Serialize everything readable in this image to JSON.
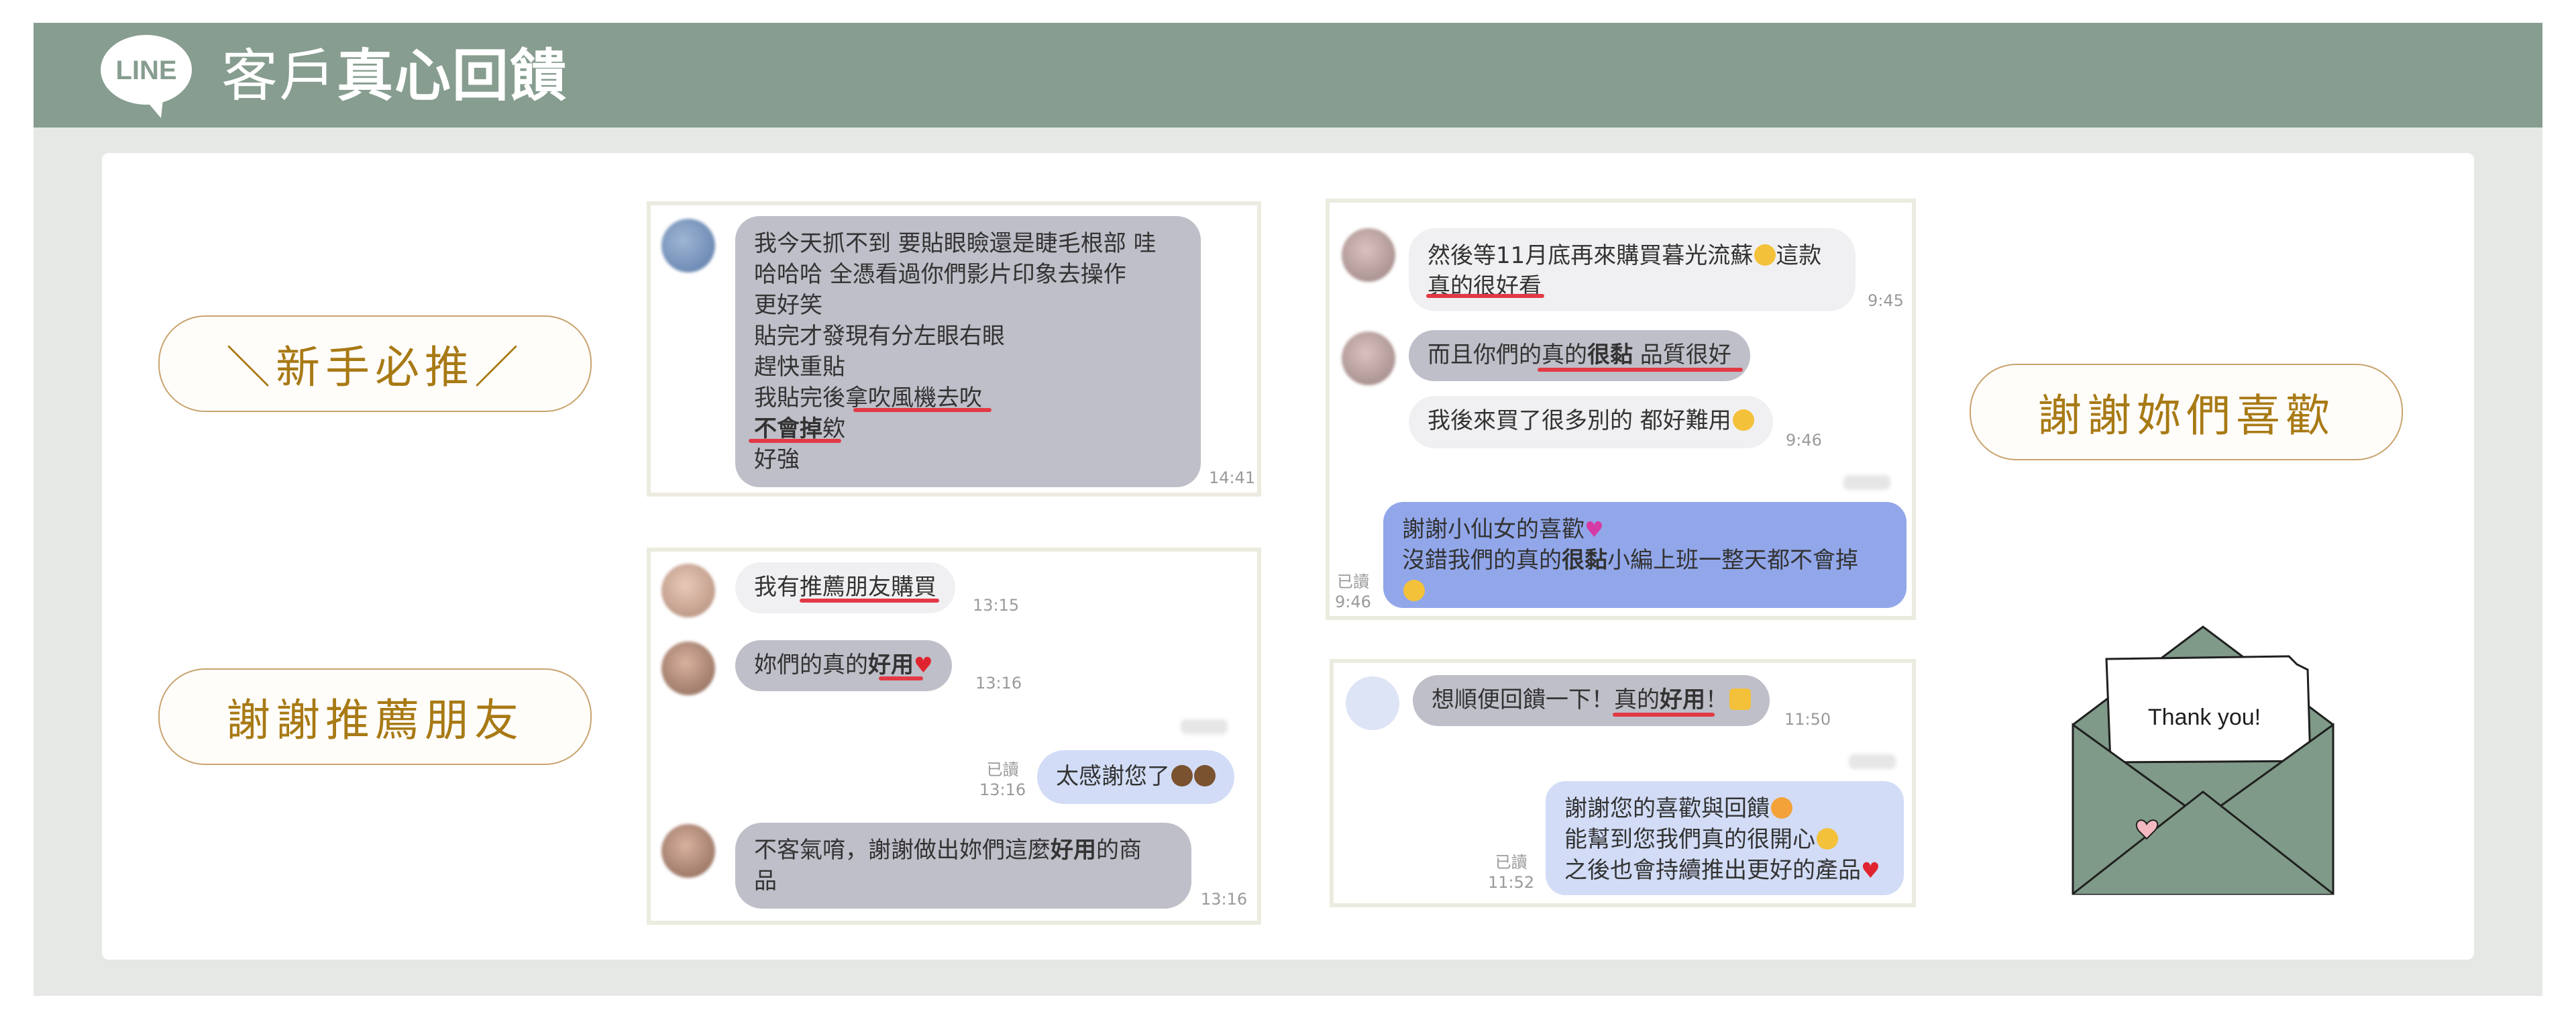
{
  "header": {
    "title_light": "客戶",
    "title_bold": "真心回饋",
    "logo_text": "LINE"
  },
  "pills": {
    "newbie": "＼新手必推／",
    "recommend": "謝謝推薦朋友",
    "thanks": "謝謝妳們喜歡"
  },
  "chat1": {
    "lines": [
      "我今天抓不到 要貼眼瞼還是睫毛根部 哇",
      "哈哈哈 全憑看過你們影片印象去操作",
      "更好笑",
      "貼完才發現有分左眼右眼",
      "趕快重貼",
      "我貼完後拿吹風機去吹"
    ],
    "line7_bold": "不會掉",
    "line7_rest": "欸",
    "line8": "好強",
    "time": "14:41"
  },
  "chat2": {
    "m1_prefix": "我有",
    "m1_highlight": "推薦朋友購買",
    "t1": "13:15",
    "m2_prefix": "妳們的真的",
    "m2_bold": "好用",
    "t2": "13:16",
    "m3": "太感謝您了",
    "read3": "已讀",
    "t3": "13:16",
    "m4_prefix": "不客氣唷，謝謝做出妳們這麼",
    "m4_bold": "好用",
    "m4_rest": "的商",
    "m4_line2": "品",
    "t4": "13:16"
  },
  "chat3": {
    "m1_line1": "然後等11月底再來購買暮光流蘇",
    "m1_after": "這款",
    "m1_line2": "真的很好看",
    "t1": "9:45",
    "m2_prefix": "而且你們的",
    "m2_mid": "真的",
    "m2_bold": "很黏",
    "m2_rest": " 品質很好",
    "m3": "我後來買了很多別的 都好難用",
    "t3": "9:46",
    "m4_line1": "謝謝小仙女的喜歡",
    "m4_line2_prefix": "沒錯我們的真的",
    "m4_line2_bold": "很黏",
    "m4_line2_rest": "小編上班一整天都不會掉",
    "read4": "已讀",
    "t4": "9:46"
  },
  "chat4": {
    "m1_prefix": "想順便回饋一下！",
    "m1_mid": "真的",
    "m1_bold": "好用",
    "m1_end": "！",
    "t1": "11:50",
    "m2_line1": "謝謝您的喜歡與回饋",
    "m2_line2": "能幫到您我們真的很開心",
    "m2_line3": "之後也會持續推出更好的產品",
    "read2": "已讀",
    "t2": "11:52"
  },
  "envelope": {
    "note": "Thank you!"
  },
  "colors": {
    "header": "#869d8f",
    "accent_gold": "#a87a15",
    "underline": "#e23a45",
    "envelope": "#7f9a88"
  }
}
